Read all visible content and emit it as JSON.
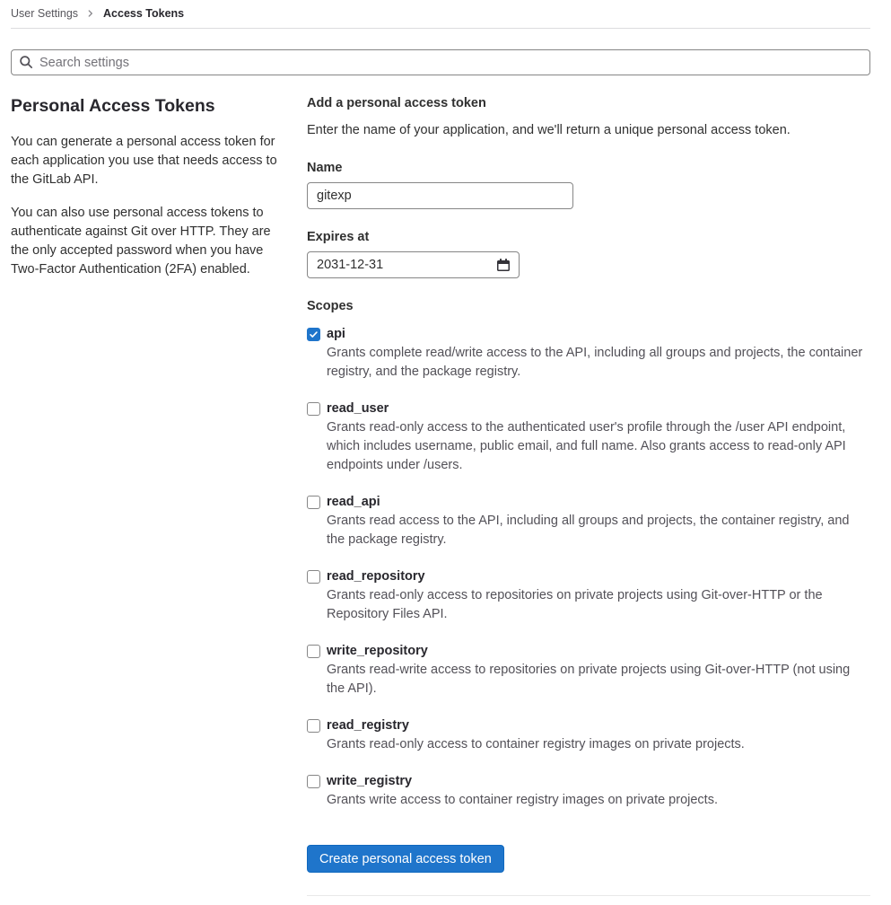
{
  "breadcrumb": {
    "parent": "User Settings",
    "current": "Access Tokens"
  },
  "search": {
    "placeholder": "Search settings"
  },
  "sidebar": {
    "title": "Personal Access Tokens",
    "paragraphs": {
      "p1": "You can generate a personal access token for each application you use that needs access to the GitLab API.",
      "p2": "You can also use personal access tokens to authenticate against Git over HTTP. They are the only accepted password when you have Two-Factor Authentication (2FA) enabled."
    }
  },
  "form": {
    "title": "Add a personal access token",
    "description": "Enter the name of your application, and we'll return a unique personal access token.",
    "name_label": "Name",
    "name_value": "gitexp",
    "expires_label": "Expires at",
    "expires_value": "2031-12-31",
    "scopes_label": "Scopes",
    "scopes": [
      {
        "name": "api",
        "checked": true,
        "description": "Grants complete read/write access to the API, including all groups and projects, the container registry, and the package registry."
      },
      {
        "name": "read_user",
        "checked": false,
        "description": "Grants read-only access to the authenticated user's profile through the /user API endpoint, which includes username, public email, and full name. Also grants access to read-only API endpoints under /users."
      },
      {
        "name": "read_api",
        "checked": false,
        "description": "Grants read access to the API, including all groups and projects, the container registry, and the package registry."
      },
      {
        "name": "read_repository",
        "checked": false,
        "description": "Grants read-only access to repositories on private projects using Git-over-HTTP or the Repository Files API."
      },
      {
        "name": "write_repository",
        "checked": false,
        "description": "Grants read-write access to repositories on private projects using Git-over-HTTP (not using the API)."
      },
      {
        "name": "read_registry",
        "checked": false,
        "description": "Grants read-only access to container registry images on private projects."
      },
      {
        "name": "write_registry",
        "checked": false,
        "description": "Grants write access to container registry images on private projects."
      }
    ],
    "submit_label": "Create personal access token"
  },
  "colors": {
    "accent_blue": "#1f75cb",
    "text_primary": "#303030",
    "text_secondary": "#535158",
    "input_border": "#868686",
    "divider": "#dcdcde"
  }
}
